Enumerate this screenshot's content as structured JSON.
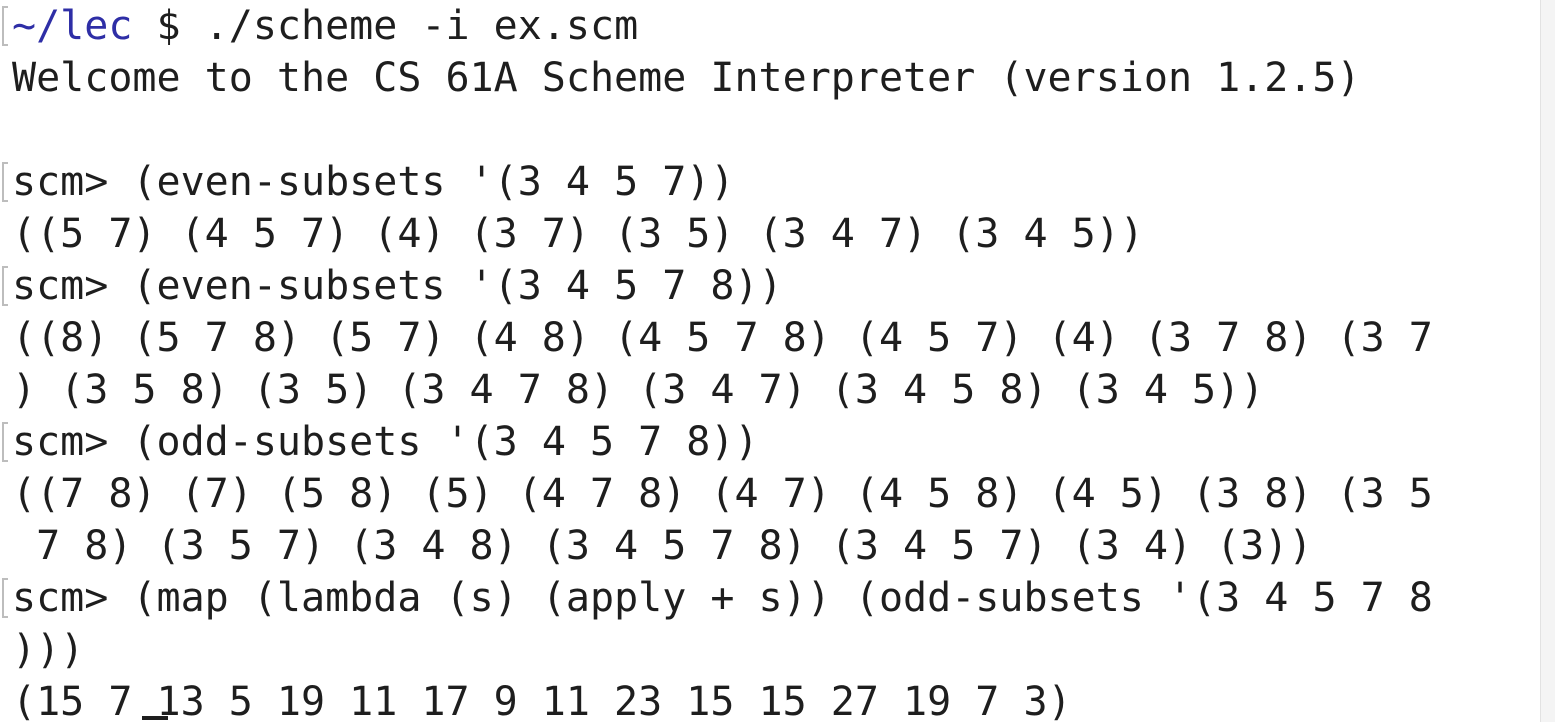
{
  "terminal": {
    "prompt_path": "~/lec",
    "prompt_symbol": " $ ",
    "command": "./scheme -i ex.scm",
    "welcome": "Welcome to the CS 61A Scheme Interpreter (version 1.2.5)",
    "scm_prompt": "scm> ",
    "entries": [
      {
        "input_lines": [
          "(even-subsets '(3 4 5 7))"
        ],
        "output_lines": [
          "((5 7) (4 5 7) (4) (3 7) (3 5) (3 4 7) (3 4 5))"
        ]
      },
      {
        "input_lines": [
          "(even-subsets '(3 4 5 7 8))"
        ],
        "output_lines": [
          "((8) (5 7 8) (5 7) (4 8) (4 5 7 8) (4 5 7) (4) (3 7 8) (3 7",
          ") (3 5 8) (3 5) (3 4 7 8) (3 4 7) (3 4 5 8) (3 4 5))"
        ]
      },
      {
        "input_lines": [
          "(odd-subsets '(3 4 5 7 8))"
        ],
        "output_lines": [
          "((7 8) (7) (5 8) (5) (4 7 8) (4 7) (4 5 8) (4 5) (3 8) (3 5",
          " 7 8) (3 5 7) (3 4 8) (3 4 5 7 8) (3 4 5 7) (3 4) (3))"
        ]
      },
      {
        "input_lines": [
          "(map (lambda (s) (apply + s)) (odd-subsets '(3 4 5 7 8",
          ")))"
        ],
        "output_lines": [
          "(15 7 13 5 19 11 17 9 11 23 15 15 27 19 7 3)"
        ]
      }
    ]
  }
}
